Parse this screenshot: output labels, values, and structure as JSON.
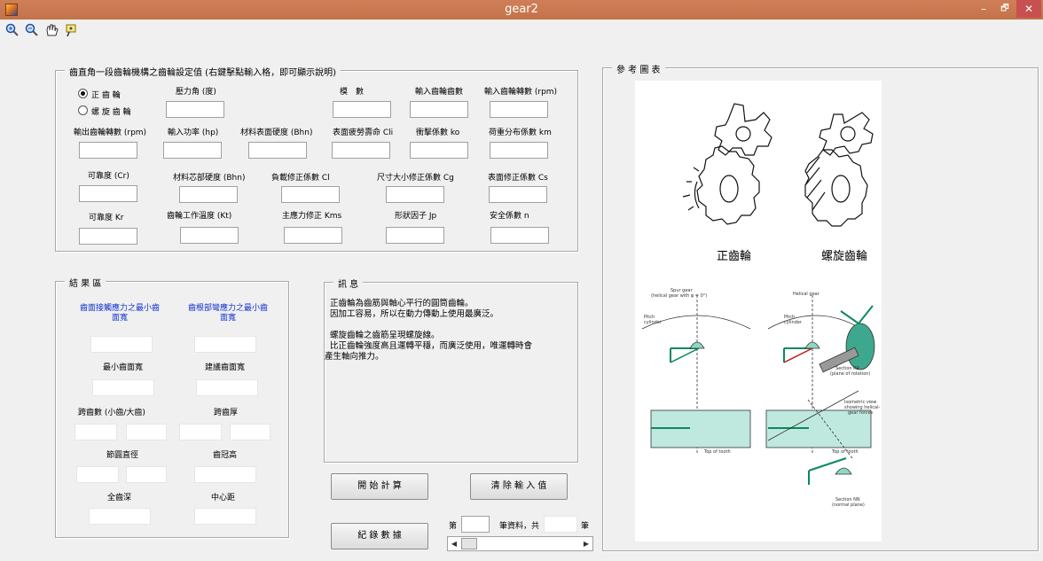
{
  "window": {
    "title": "gear2",
    "minimize": "–",
    "maximize": "🗗",
    "close": "✕"
  },
  "toolbar": {
    "icons": [
      "zoom-in-icon",
      "zoom-out-icon",
      "pan-icon",
      "data-cursor-icon"
    ],
    "glyphs": [
      "🔍",
      "🔍",
      "✋",
      "⌖"
    ]
  },
  "settings": {
    "title": "齒直角一段齒輪機構之齒輪設定值 (右鍵擊點輸入格，即可顯示說明)",
    "gear_type": {
      "spur": "正 齒 輪",
      "helical": "螺 旋 齒 輪",
      "selected": "spur"
    },
    "labels": {
      "pressure_angle": "壓力角 (度)",
      "module": "模　數",
      "input_teeth": "輸入齒輪齒數",
      "input_speed": "輸入齒輪轉數 (rpm)",
      "output_speed": "輸出齒輪轉數 (rpm)",
      "input_power": "輸入功率 (hp)",
      "surface_hardness": "材料表面硬度 (Bhn)",
      "fatigue_life": "表面疲勞壽命 Cli",
      "impact_factor": "衝擊係數 ko",
      "load_dist": "荷重分布係數 km",
      "reliability_cr": "可靠度 (Cr)",
      "core_hardness": "材料芯部硬度 (Bhn)",
      "load_correction": "負載修正係數 Cl",
      "size_correction": "尺寸大小修正係數 Cg",
      "surface_correction": "表面修正係數 Cs",
      "reliability_kr": "可靠度 Kr",
      "temp": "齒輪工作溫度 (Kt)",
      "stress_correction": "主應力修正 Kms",
      "form_factor": "形狀因子 Jp",
      "safety": "安全係數 n"
    }
  },
  "results": {
    "title": "結 果 區",
    "contact_width": "齒面接觸應力之最小齒面寬",
    "root_width": "齒根部彎應力之最小齒面寬",
    "min_width": "最小齒面寬",
    "suggest_width": "建議齒面寬",
    "teeth": "跨齒數 (小齒/大齒)",
    "tooth_thickness": "跨齒厚",
    "pitch_diameter": "節圓直徑",
    "addendum": "齒冠高",
    "whole_depth": "全齒深",
    "center_distance": "中心距"
  },
  "message": {
    "title": "訊 息",
    "lines": [
      "正齒輪為齒筋與軸心平行的圓筒齒輪。",
      "因加工容易，所以在動力傳動上使用最廣泛。",
      "",
      "螺旋齒輪之齒筋呈現螺旋線。",
      "比正齒輪強度高且運轉平穩，而廣泛使用，唯運轉時會",
      "產生軸向推力。"
    ]
  },
  "buttons": {
    "start": "開 始 計 算",
    "clear": "清 除 輸 入 值",
    "record": "紀 錄 數 據"
  },
  "record_nav": {
    "prefix": "第",
    "middle": "筆資料，共",
    "suffix": "筆"
  },
  "reference": {
    "title": "參 考 圖 表",
    "spur_caption": "正齒輪",
    "helical_caption": "螺旋齒輪",
    "diagram": {
      "spur_header": "Spur gear\n(helical gear with ψ = 0°)",
      "helical_header": "Helical gear",
      "pitch_cylinder": "Pitch\ncylinder",
      "section_rr": "Section RR\n(plane of rotation)",
      "top_of_tooth": "Top of tooth",
      "section_nn": "Section NN\n(normal plane)",
      "isometric": "Isometric view\nshowing helical-\ngear forces"
    }
  }
}
